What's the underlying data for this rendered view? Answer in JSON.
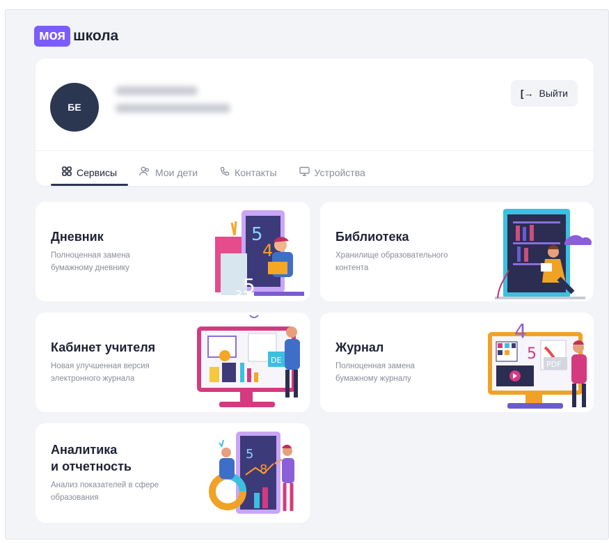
{
  "logo": {
    "box": "моя",
    "text": "школа"
  },
  "profile": {
    "initials": "БЕ",
    "logout_label": "Выйти"
  },
  "tabs": [
    {
      "label": "Сервисы",
      "icon": "grid-icon",
      "active": true
    },
    {
      "label": "Мои дети",
      "icon": "people-icon",
      "active": false
    },
    {
      "label": "Контакты",
      "icon": "phone-icon",
      "active": false
    },
    {
      "label": "Устройства",
      "icon": "monitor-icon",
      "active": false
    }
  ],
  "cards": {
    "diary": {
      "title": "Дневник",
      "desc": "Полноценная замена бумажному дневнику"
    },
    "library": {
      "title": "Библиотека",
      "desc": "Хранилище образовательного контента"
    },
    "teacher": {
      "title": "Кабинет учителя",
      "desc": "Новая улучшенная версия электронного журнала"
    },
    "journal": {
      "title": "Журнал",
      "desc": "Полноценная замена бумажному журналу"
    },
    "analytics": {
      "title_line1": "Аналитика",
      "title_line2": "и отчетность",
      "desc": "Анализ показателей в сфере образования"
    }
  },
  "illustration_text": {
    "diary_digits": [
      "5",
      "4",
      "3",
      "5"
    ],
    "teacher_doc": "DE",
    "journal_digits": [
      "4",
      "5"
    ],
    "journal_doc": "PDF",
    "analytics_digits": [
      "5",
      "8"
    ]
  },
  "colors": {
    "accent": "#7b5cff",
    "avatar": "#2b3651",
    "background": "#f3f4f8"
  }
}
